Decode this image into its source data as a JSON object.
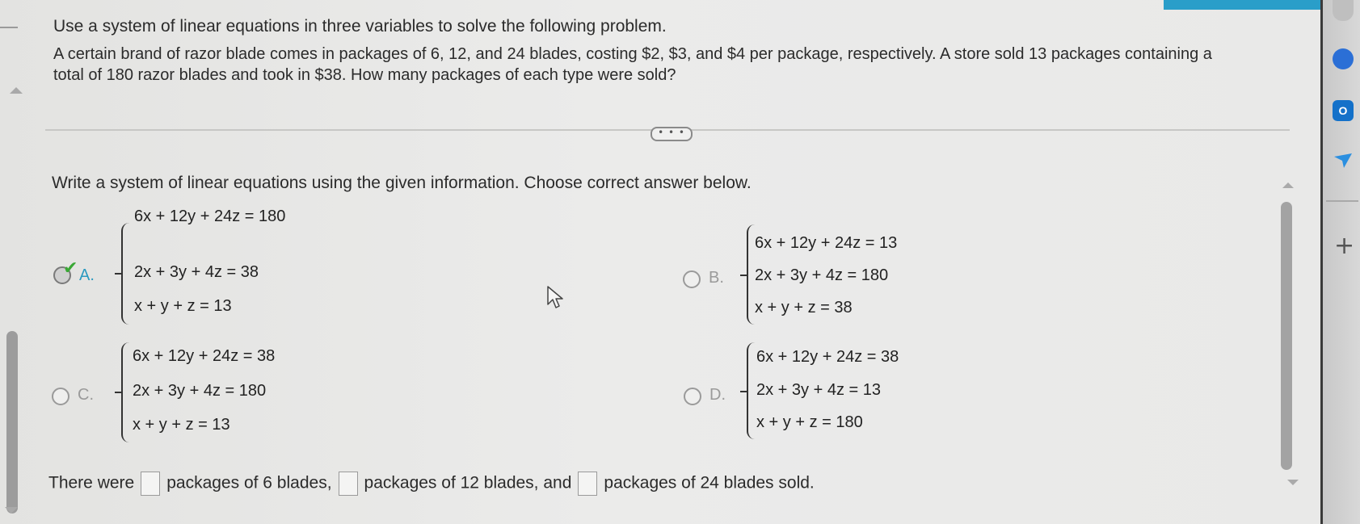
{
  "instruction": "Use a system of linear equations in three variables to solve the following problem.",
  "problem": "A certain brand of razor blade comes in packages of 6, 12, and 24 blades, costing $2, $3, and $4 per package, respectively. A store sold 13 packages containing a total of 180 razor blades and took in $38. How many packages of each type were sold?",
  "more_button": "• • •",
  "prompt": "Write a system of linear equations using the given information. Choose correct answer below.",
  "options": [
    {
      "letter": "A.",
      "selected": true,
      "equations": [
        "6x + 12y + 24z = 180",
        "2x + 3y + 4z = 38",
        "x + y + z = 13"
      ]
    },
    {
      "letter": "B.",
      "selected": false,
      "equations": [
        "6x + 12y + 24z = 13",
        "2x + 3y + 4z = 180",
        "x + y + z = 38"
      ]
    },
    {
      "letter": "C.",
      "selected": false,
      "equations": [
        "6x + 12y + 24z = 38",
        "2x + 3y + 4z = 180",
        "x + y + z = 13"
      ]
    },
    {
      "letter": "D.",
      "selected": false,
      "equations": [
        "6x + 12y + 24z = 38",
        "2x + 3y + 4z = 13",
        "x + y + z = 180"
      ]
    }
  ],
  "answer": {
    "part1": "There were",
    "part2": "packages of 6 blades,",
    "part3": "packages of 12 blades, and",
    "part4": "packages of 24 blades sold."
  },
  "dock": {
    "outlook_letter": "O",
    "plus": "+"
  },
  "colors": {
    "accent": "#2b9ac0",
    "check": "#3aa835"
  }
}
